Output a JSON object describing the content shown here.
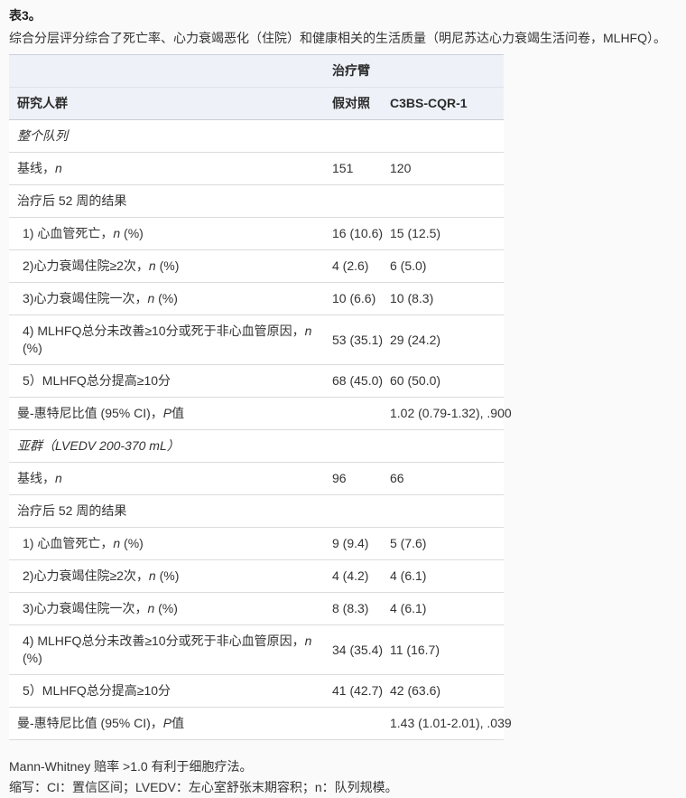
{
  "page": {
    "title": "表3。",
    "subtitle": "综合分层评分综合了死亡率、心力衰竭恶化（住院）和健康相关的生活质量（明尼苏达心力衰竭生活问卷，MLHFQ）。"
  },
  "colors": {
    "page_bg": "#fafafa",
    "header_bg": "#eef2f8",
    "header_border": "#c9ced6",
    "row_border": "#dadcdf",
    "text": "#333333"
  },
  "table": {
    "header": {
      "treatment_arm": "治疗臂",
      "population": "研究人群",
      "columns": [
        "假对照",
        "C3BS-CQR-1"
      ]
    },
    "rows": [
      {
        "type": "section",
        "pre": "整个队列",
        "sham": "",
        "c3bs": ""
      },
      {
        "type": "plain",
        "pre": "基线，",
        "it": "n",
        "post": "",
        "sham": "151",
        "c3bs": "120"
      },
      {
        "type": "plain",
        "pre": "治疗后 52 周的结果",
        "sham": "",
        "c3bs": ""
      },
      {
        "type": "indent",
        "pre": "1) 心血管死亡，",
        "it": "n",
        "post": " (%)",
        "sham": "16 (10.6)",
        "c3bs": "15 (12.5)"
      },
      {
        "type": "indent",
        "pre": "2)心力衰竭住院≥2次，",
        "it": "n",
        "post": " (%)",
        "sham": "4 (2.6)",
        "c3bs": "6 (5.0)"
      },
      {
        "type": "indent",
        "pre": "3)心力衰竭住院一次，",
        "it": "n",
        "post": " (%)",
        "sham": "10 (6.6)",
        "c3bs": "10 (8.3)"
      },
      {
        "type": "indent",
        "pre": "4) MLHFQ总分未改善≥10分或死于非心血管原因，",
        "it": "n",
        "post": " (%)",
        "sham": "53 (35.1)",
        "c3bs": "29 (24.2)"
      },
      {
        "type": "indent",
        "pre": "5）MLHFQ总分提高≥10分",
        "sham": "68 (45.0)",
        "c3bs": "60 (50.0)"
      },
      {
        "type": "plain",
        "pre": "曼-惠特尼比值 (95% CI)，",
        "it": "P",
        "post": "值",
        "sham": "",
        "c3bs": "1.02 (0.79-1.32), .900"
      },
      {
        "type": "section",
        "pre": "亚群（LVEDV 200-370 mL）",
        "sham": "",
        "c3bs": ""
      },
      {
        "type": "plain",
        "pre": "基线，",
        "it": "n",
        "post": "",
        "sham": "96",
        "c3bs": "66"
      },
      {
        "type": "plain",
        "pre": "治疗后 52 周的结果",
        "sham": "",
        "c3bs": ""
      },
      {
        "type": "indent",
        "pre": "1) 心血管死亡，",
        "it": "n",
        "post": " (%)",
        "sham": "9 (9.4)",
        "c3bs": "5 (7.6)"
      },
      {
        "type": "indent",
        "pre": "2)心力衰竭住院≥2次，",
        "it": "n",
        "post": " (%)",
        "sham": "4 (4.2)",
        "c3bs": "4 (6.1)"
      },
      {
        "type": "indent",
        "pre": "3)心力衰竭住院一次，",
        "it": "n",
        "post": " (%)",
        "sham": "8 (8.3)",
        "c3bs": "4 (6.1)"
      },
      {
        "type": "indent",
        "pre": "4) MLHFQ总分未改善≥10分或死于非心血管原因，",
        "it": "n",
        "post": " (%)",
        "sham": "34 (35.4)",
        "c3bs": "11 (16.7)"
      },
      {
        "type": "indent",
        "pre": "5）MLHFQ总分提高≥10分",
        "sham": "41 (42.7)",
        "c3bs": "42 (63.6)"
      },
      {
        "type": "plain",
        "pre": "曼-惠特尼比值 (95% CI)，",
        "it": "P",
        "post": "值",
        "sham": "",
        "c3bs": "1.43 (1.01-2.01), .039"
      }
    ]
  },
  "footnotes": [
    "Mann-Whitney 赔率 >1.0 有利于细胞疗法。",
    "缩写：CI：置信区间；LVEDV：左心室舒张末期容积；n：队列规模。"
  ]
}
